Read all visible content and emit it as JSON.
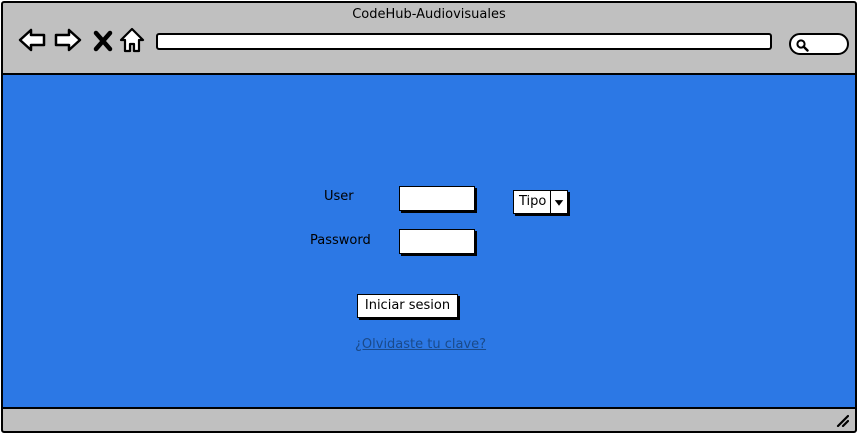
{
  "window": {
    "title": "CodeHub-Audiovisuales"
  },
  "toolbar": {
    "icons": [
      "back-arrow-icon",
      "forward-arrow-icon",
      "close-x-icon",
      "home-icon",
      "search-icon"
    ],
    "address_value": ""
  },
  "login": {
    "user_label": "User",
    "password_label": "Password",
    "user_value": "",
    "password_value": "",
    "type_select_value": "Tipo",
    "submit_label": "Iniciar sesion",
    "forgot_link": "¿Olvidaste tu clave?"
  },
  "colors": {
    "content_background": "#2c78e5",
    "chrome_background": "#c0c0c0",
    "link": "#1a4a8a"
  }
}
